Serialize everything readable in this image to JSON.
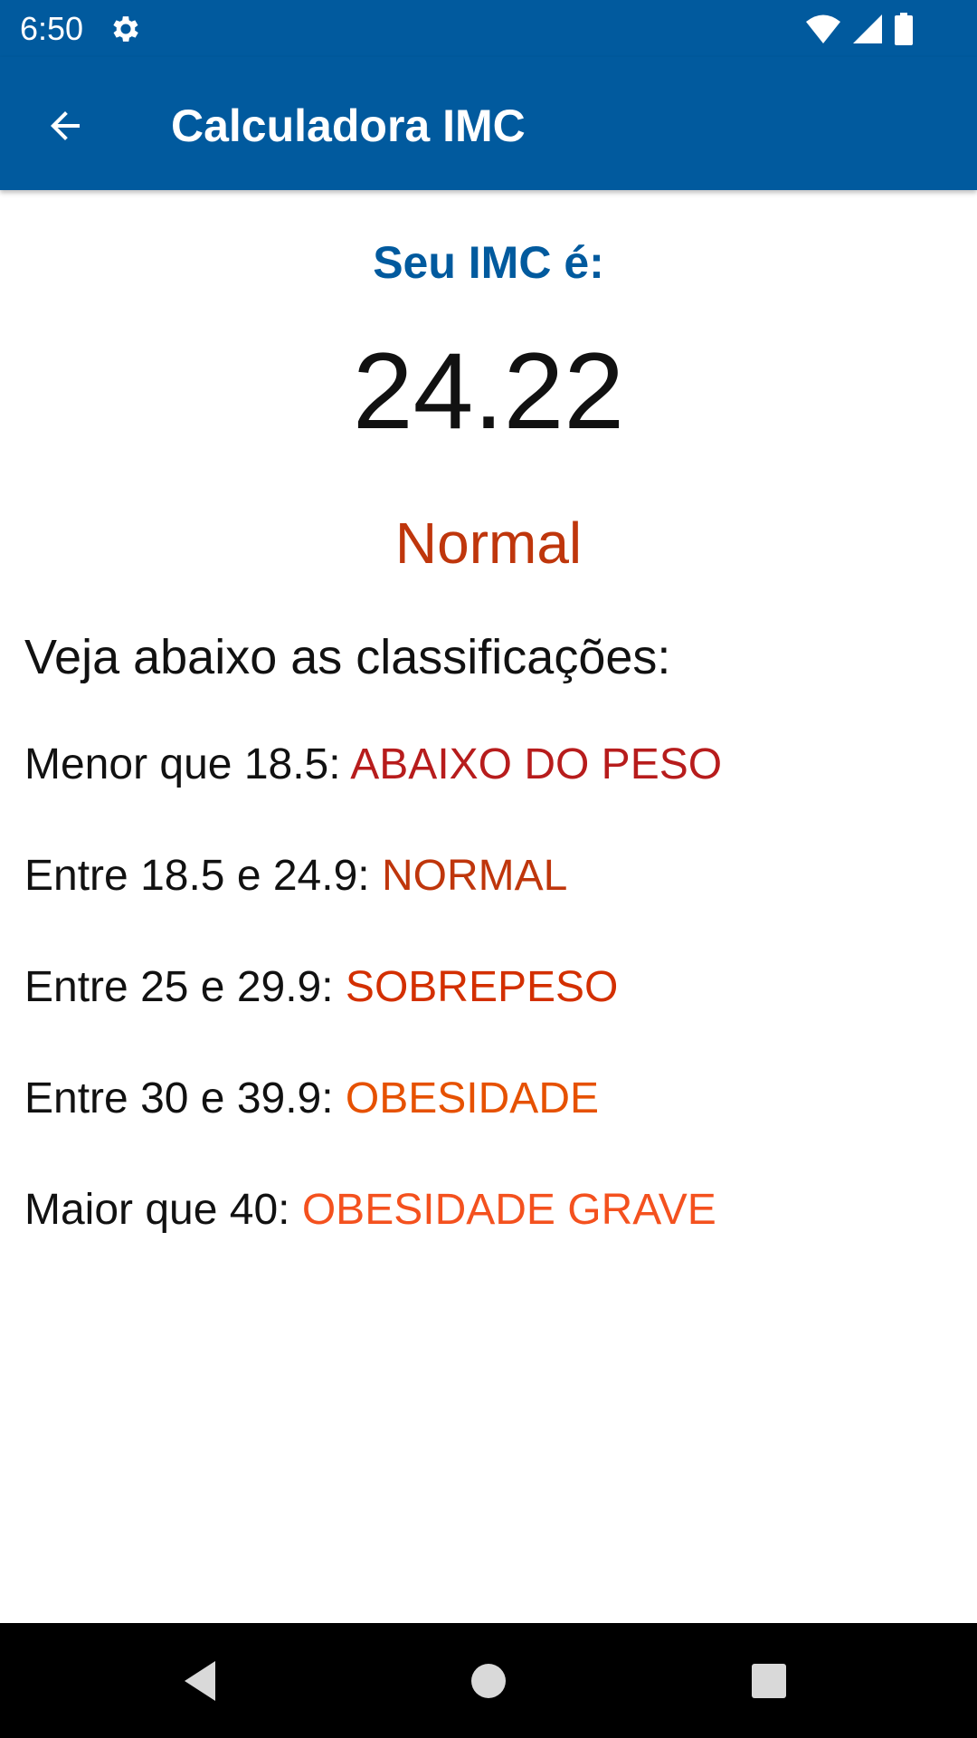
{
  "status_bar": {
    "time": "6:50",
    "icons": [
      "gear-icon",
      "wifi-icon",
      "signal-icon",
      "battery-icon"
    ]
  },
  "app_bar": {
    "title": "Calculadora IMC",
    "back_icon": "arrow-back-icon"
  },
  "result": {
    "label": "Seu IMC é:",
    "value": "24.22",
    "classification": "Normal"
  },
  "classifications": {
    "heading": "Veja abaixo as classificações:",
    "rows": [
      {
        "range": "Menor que 18.5: ",
        "category": "ABAIXO DO PESO",
        "color": "#B71C1C"
      },
      {
        "range": "Entre 18.5 e 24.9: ",
        "category": "NORMAL",
        "color": "#BF360C"
      },
      {
        "range": "Entre 25 e 29.9: ",
        "category": "SOBREPESO",
        "color": "#D32F00"
      },
      {
        "range": "Entre 30 e 39.9: ",
        "category": "OBESIDADE",
        "color": "#E65100"
      },
      {
        "range": "Maior que 40: ",
        "category": "OBESIDADE GRAVE",
        "color": "#F4511E"
      }
    ]
  },
  "nav_bar": {
    "icons": [
      "back-triangle-icon",
      "home-circle-icon",
      "recents-square-icon"
    ]
  },
  "colors": {
    "primary": "#015A9E",
    "text": "#111111"
  }
}
